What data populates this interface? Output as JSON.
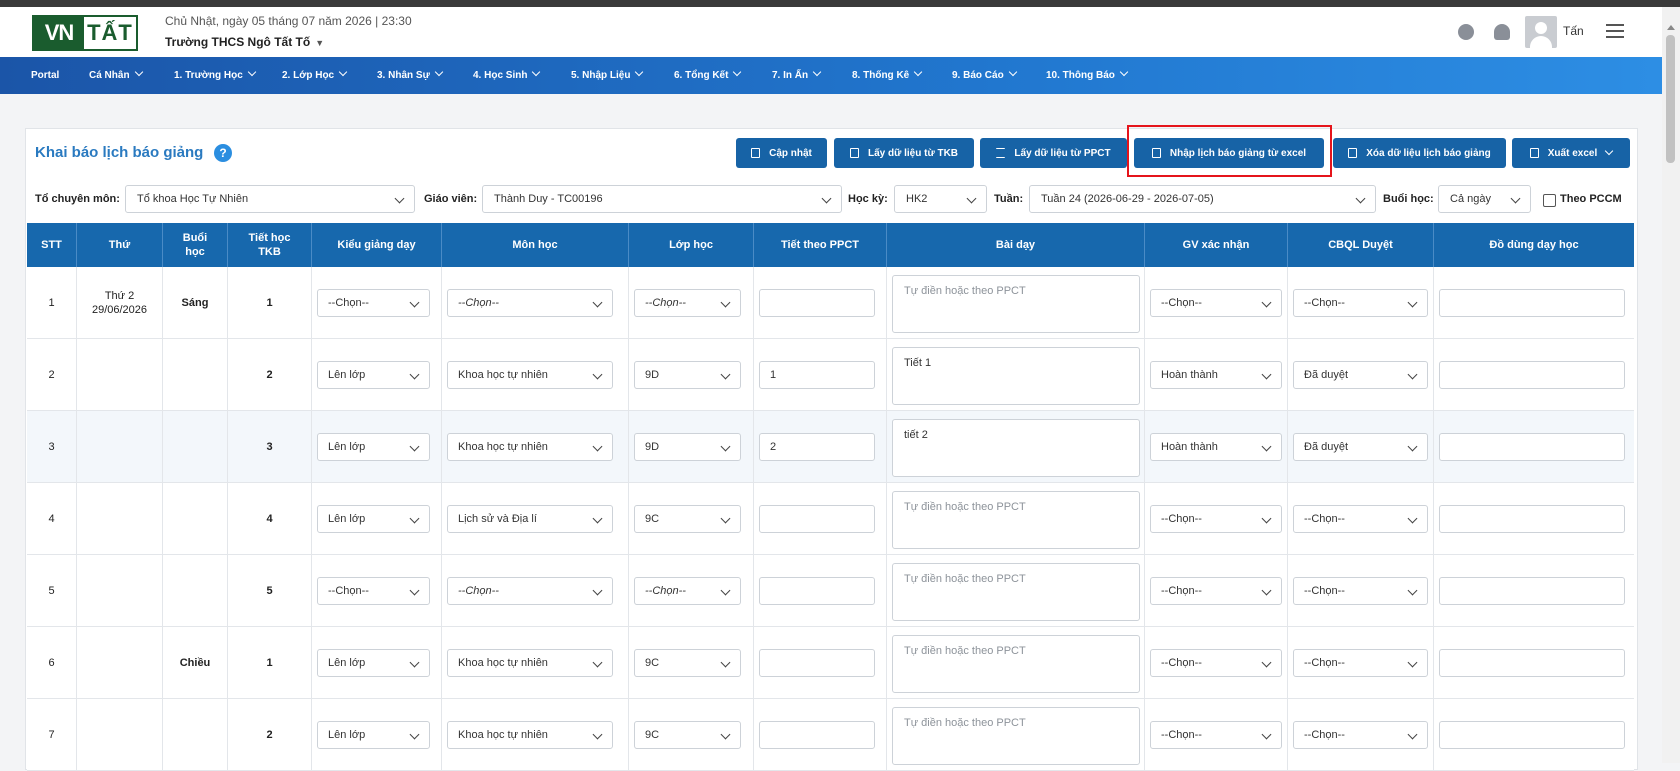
{
  "header": {
    "logo_left": "VN",
    "logo_right": "TẤT",
    "datetime": "Chủ Nhật, ngày 05 tháng 07 năm 2026 | 23:30",
    "school": "Trường THCS Ngô Tất Tố",
    "username": "Tấn"
  },
  "nav": {
    "items": [
      {
        "label": "Portal"
      },
      {
        "label": "Cá Nhân"
      },
      {
        "label": "1. Trường Học"
      },
      {
        "label": "2. Lớp Học"
      },
      {
        "label": "3. Nhân Sự"
      },
      {
        "label": "4. Học Sinh"
      },
      {
        "label": "5. Nhập Liệu"
      },
      {
        "label": "6. Tổng Kết"
      },
      {
        "label": "7. In Ấn"
      },
      {
        "label": "8. Thống Kê"
      },
      {
        "label": "9. Báo Cáo"
      },
      {
        "label": "10. Thông Báo"
      }
    ]
  },
  "page": {
    "title": "Khai báo lịch báo giảng",
    "help": "?"
  },
  "toolbar": {
    "update": "Cập nhật",
    "from_tkb": "Lấy dữ liệu từ TKB",
    "from_ppct": "Lấy dữ liệu từ PPCT",
    "import_excel": "Nhập lịch báo giảng từ excel",
    "delete": "Xóa dữ liệu lịch báo giảng",
    "export": "Xuất excel"
  },
  "filters": {
    "department_label": "Tổ chuyên môn:",
    "department_value": "Tổ khoa Học Tự Nhiên",
    "teacher_label": "Giáo viên:",
    "teacher_value": "Thành Duy - TC00196",
    "semester_label": "Học kỳ:",
    "semester_value": "HK2",
    "week_label": "Tuần:",
    "week_value": "Tuần 24 (2026-06-29 - 2026-07-05)",
    "session_label": "Buổi học:",
    "session_value": "Cả ngày",
    "pccm_label": "Theo PCCM"
  },
  "table": {
    "headers": [
      "STT",
      "Thứ",
      "Buổi học",
      "Tiết học TKB",
      "Kiểu giảng dạy",
      "Môn học",
      "Lớp học",
      "Tiết theo PPCT",
      "Bài dạy",
      "GV xác nhận",
      "CBQL Duyệt",
      "Đồ dùng dạy học"
    ],
    "rows": [
      {
        "stt": "1",
        "thu": "Thứ 2",
        "ngay": "29/06/2026",
        "buoi": "Sáng",
        "tiet": "1",
        "kieu": "--Chọn--",
        "mon": "--Chọn--",
        "lop": "--Chọn--",
        "ppct": "",
        "bai": "Tự điền hoặc theo PPCT",
        "gv": "--Chọn--",
        "cbql": "--Chọn--",
        "dodung": ""
      },
      {
        "stt": "2",
        "thu": "",
        "ngay": "",
        "buoi": "",
        "tiet": "2",
        "kieu": "Lên lớp",
        "mon": "Khoa học tự nhiên",
        "lop": "9D",
        "ppct": "1",
        "bai": "Tiết 1",
        "gv": "Hoàn thành",
        "cbql": "Đã duyệt",
        "dodung": ""
      },
      {
        "stt": "3",
        "thu": "",
        "ngay": "",
        "buoi": "",
        "tiet": "3",
        "kieu": "Lên lớp",
        "mon": "Khoa học tự nhiên",
        "lop": "9D",
        "ppct": "2",
        "bai": "tiết 2",
        "gv": "Hoàn thành",
        "cbql": "Đã duyệt",
        "dodung": ""
      },
      {
        "stt": "4",
        "thu": "",
        "ngay": "",
        "buoi": "",
        "tiet": "4",
        "kieu": "Lên lớp",
        "mon": "Lịch sử và Địa lí",
        "lop": "9C",
        "ppct": "",
        "bai": "Tự điền hoặc theo PPCT",
        "gv": "--Chọn--",
        "cbql": "--Chọn--",
        "dodung": ""
      },
      {
        "stt": "5",
        "thu": "",
        "ngay": "",
        "buoi": "",
        "tiet": "5",
        "kieu": "--Chọn--",
        "mon": "--Chọn--",
        "lop": "--Chọn--",
        "ppct": "",
        "bai": "Tự điền hoặc theo PPCT",
        "gv": "--Chọn--",
        "cbql": "--Chọn--",
        "dodung": ""
      },
      {
        "stt": "6",
        "thu": "",
        "ngay": "",
        "buoi": "Chiều",
        "tiet": "1",
        "kieu": "Lên lớp",
        "mon": "Khoa học tự nhiên",
        "lop": "9C",
        "ppct": "",
        "bai": "Tự điền hoặc theo PPCT",
        "gv": "--Chọn--",
        "cbql": "--Chọn--",
        "dodung": ""
      },
      {
        "stt": "7",
        "thu": "",
        "ngay": "",
        "buoi": "",
        "tiet": "2",
        "kieu": "Lên lớp",
        "mon": "Khoa học tự nhiên",
        "lop": "9C",
        "ppct": "",
        "bai": "Tự điền hoặc theo PPCT",
        "gv": "--Chọn--",
        "cbql": "--Chọn--",
        "dodung": ""
      }
    ]
  }
}
